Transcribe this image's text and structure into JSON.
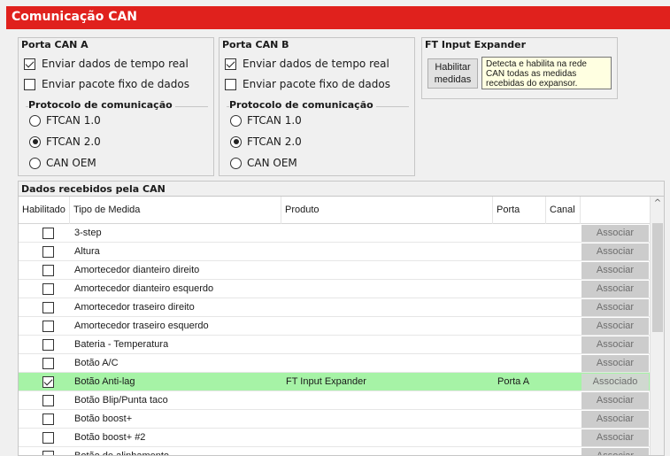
{
  "window": {
    "title": "Comunicação CAN"
  },
  "porta_a": {
    "title": "Porta CAN A",
    "enviar_tempo_real": {
      "label": "Enviar dados de tempo real",
      "checked": true
    },
    "enviar_pacote": {
      "label": "Enviar pacote fixo de dados",
      "checked": false
    },
    "protocolo_label": "Protocolo de comunicação",
    "options": [
      {
        "label": "FTCAN 1.0",
        "checked": false
      },
      {
        "label": "FTCAN 2.0",
        "checked": true
      },
      {
        "label": "CAN OEM",
        "checked": false
      }
    ]
  },
  "porta_b": {
    "title": "Porta CAN B",
    "enviar_tempo_real": {
      "label": "Enviar dados de tempo real",
      "checked": true
    },
    "enviar_pacote": {
      "label": "Enviar pacote fixo de dados",
      "checked": false
    },
    "protocolo_label": "Protocolo de comunicação",
    "options": [
      {
        "label": "FTCAN 1.0",
        "checked": false
      },
      {
        "label": "FTCAN 2.0",
        "checked": true
      },
      {
        "label": "CAN OEM",
        "checked": false
      }
    ]
  },
  "expander": {
    "title": "FT Input Expander",
    "button_line1": "Habilitar",
    "button_line2": "medidas",
    "tooltip": "Detecta e habilita na rede CAN todas as medidas recebidas do expansor."
  },
  "table": {
    "caption": "Dados recebidos pela CAN",
    "headers": {
      "habilitado": "Habilitado",
      "tipo": "Tipo de Medida",
      "produto": "Produto",
      "porta": "Porta",
      "canal": "Canal"
    },
    "rows": [
      {
        "checked": false,
        "tipo": "3-step",
        "produto": "",
        "porta": "",
        "canal": "",
        "action": "Associar"
      },
      {
        "checked": false,
        "tipo": "Altura",
        "produto": "",
        "porta": "",
        "canal": "",
        "action": "Associar"
      },
      {
        "checked": false,
        "tipo": "Amortecedor dianteiro direito",
        "produto": "",
        "porta": "",
        "canal": "",
        "action": "Associar"
      },
      {
        "checked": false,
        "tipo": "Amortecedor dianteiro esquerdo",
        "produto": "",
        "porta": "",
        "canal": "",
        "action": "Associar"
      },
      {
        "checked": false,
        "tipo": "Amortecedor traseiro direito",
        "produto": "",
        "porta": "",
        "canal": "",
        "action": "Associar"
      },
      {
        "checked": false,
        "tipo": "Amortecedor traseiro esquerdo",
        "produto": "",
        "porta": "",
        "canal": "",
        "action": "Associar"
      },
      {
        "checked": false,
        "tipo": "Bateria - Temperatura",
        "produto": "",
        "porta": "",
        "canal": "",
        "action": "Associar"
      },
      {
        "checked": false,
        "tipo": "Botão A/C",
        "produto": "",
        "porta": "",
        "canal": "",
        "action": "Associar"
      },
      {
        "checked": true,
        "tipo": "Botão Anti-lag",
        "produto": "FT Input Expander",
        "porta": "Porta A",
        "canal": "",
        "action": "Associado",
        "selected": true
      },
      {
        "checked": false,
        "tipo": "Botão Blip/Punta taco",
        "produto": "",
        "porta": "",
        "canal": "",
        "action": "Associar"
      },
      {
        "checked": false,
        "tipo": "Botão boost+",
        "produto": "",
        "porta": "",
        "canal": "",
        "action": "Associar"
      },
      {
        "checked": false,
        "tipo": "Botão boost+ #2",
        "produto": "",
        "porta": "",
        "canal": "",
        "action": "Associar"
      },
      {
        "checked": false,
        "tipo": "Botão de alinhamento",
        "produto": "",
        "porta": "",
        "canal": "",
        "action": "Associar"
      }
    ]
  }
}
